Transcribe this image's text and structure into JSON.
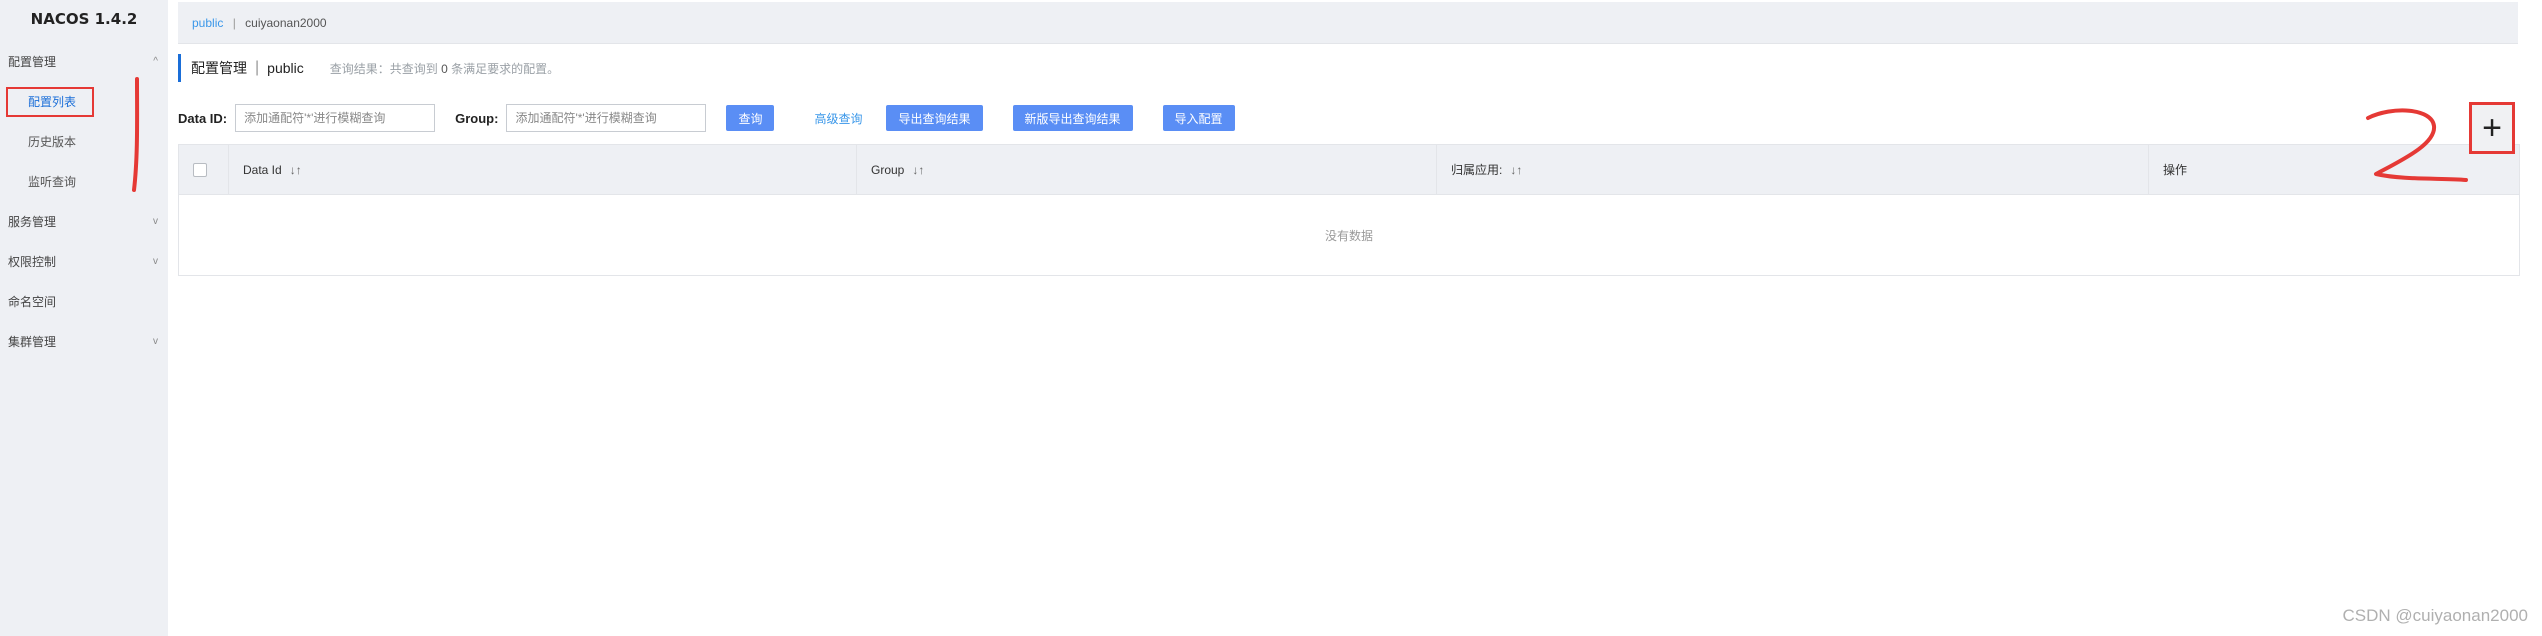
{
  "sidebar": {
    "brand": "NACOS 1.4.2",
    "groups": [
      {
        "label": "配置管理",
        "chevron": "^"
      },
      {
        "label": "服务管理",
        "chevron": "v"
      },
      {
        "label": "权限控制",
        "chevron": "v"
      },
      {
        "label": "命名空间"
      },
      {
        "label": "集群管理",
        "chevron": "v"
      }
    ],
    "config_items": [
      "配置列表",
      "历史版本",
      "监听查询"
    ]
  },
  "topbar": {
    "namespace_active": "public",
    "separator": "|",
    "namespace_user": "cuiyaonan2000"
  },
  "title": {
    "main": "配置管理",
    "separator": "|",
    "namespace": "public",
    "result_prefix": "查询结果：共查询到",
    "result_count": "0",
    "result_suffix": "条满足要求的配置。"
  },
  "filters": {
    "data_id_label": "Data ID:",
    "data_id_placeholder": "添加通配符'*'进行模糊查询",
    "group_label": "Group:",
    "group_placeholder": "添加通配符'*'进行模糊查询",
    "query_label": "查询",
    "advanced_label": "高级查询",
    "export_label": "导出查询结果",
    "export_new_label": "新版导出查询结果",
    "import_label": "导入配置"
  },
  "add_button": {
    "label": "+"
  },
  "table": {
    "columns": [
      "Data Id",
      "Group",
      "归属应用:",
      "操作"
    ],
    "sort_glyph": "↓↑",
    "empty_text": "没有数据"
  },
  "watermark": "CSDN @cuiyaonan2000",
  "colors": {
    "accent": "#5a8ef5",
    "link": "#3a97e9",
    "annotation": "#e53935"
  }
}
